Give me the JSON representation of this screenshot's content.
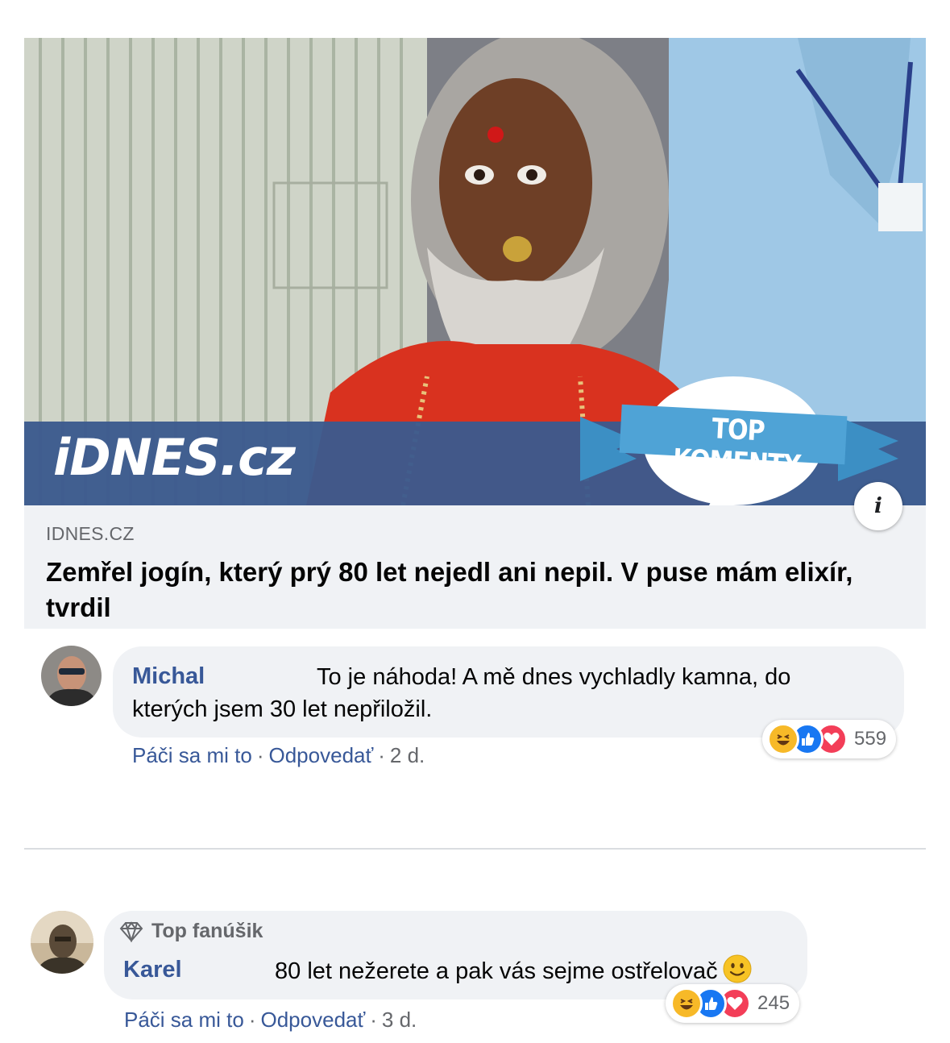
{
  "post": {
    "image_brand": "iDNES.cz",
    "image_badge": "TOP KOMENTY",
    "domain": "IDNES.CZ",
    "headline": "Zemřel jogín, který prý 80 let nejedl ani nepil. V puse mám elixír, tvrdil",
    "info_icon": "i"
  },
  "comments": [
    {
      "author": "Michal",
      "text": "To je náhoda! A mě dnes vychladly kamna, do kterých jsem 30 let nepřiložil.",
      "like": "Páči sa mi to",
      "reply": "Odpovedať",
      "time": "2 d.",
      "reaction_count": "559",
      "reactions": [
        "haha-icon",
        "like-icon",
        "love-icon"
      ]
    },
    {
      "badge": "Top fanúšik",
      "author": "Karel",
      "text": "80 let nežerete a pak vás sejme ostřelovač",
      "emoji": "slightly-smiling-face-icon",
      "like": "Páči sa mi to",
      "reply": "Odpovedať",
      "time": "3 d.",
      "reaction_count": "245",
      "reactions": [
        "haha-icon",
        "like-icon",
        "love-icon"
      ]
    }
  ],
  "colors": {
    "link_blue": "#385898",
    "bubble_bg": "#f0f2f5",
    "meta_gray": "#65676b",
    "banner_blue": "#3b5a8e",
    "ribbon_blue": "#4fa3d6",
    "like_blue": "#1877f2",
    "love_red": "#f33e58",
    "haha_yellow": "#f7b928"
  }
}
